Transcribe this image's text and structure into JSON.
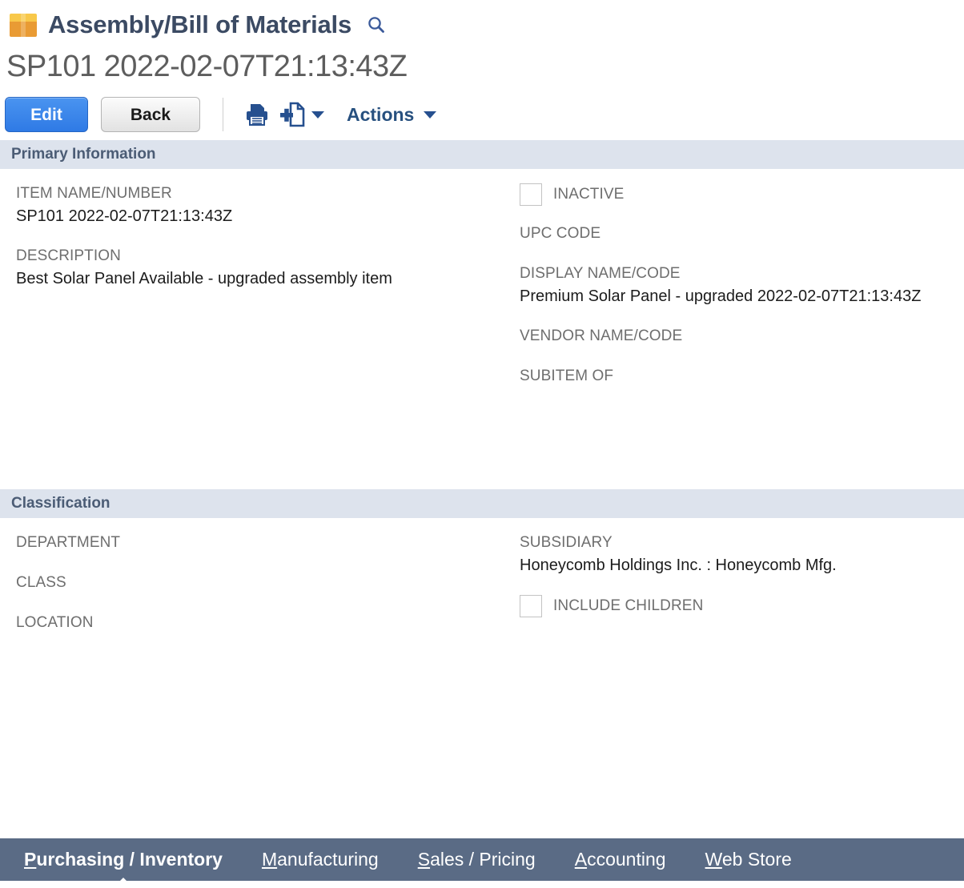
{
  "header": {
    "record_type_icon": "package-box-icon",
    "record_type": "Assembly/Bill of Materials",
    "search_icon": "search-icon"
  },
  "record": {
    "title": "SP101 2022-02-07T21:13:43Z"
  },
  "toolbar": {
    "edit_label": "Edit",
    "back_label": "Back",
    "print_icon": "print-icon",
    "new_document_icon": "new-document-icon",
    "actions_label": "Actions"
  },
  "sections": [
    {
      "title": "Primary Information",
      "left_fields": [
        {
          "label": "ITEM NAME/NUMBER",
          "value": "SP101 2022-02-07T21:13:43Z"
        },
        {
          "label": "DESCRIPTION",
          "value": "Best Solar Panel Available - upgraded assembly item"
        }
      ],
      "right_checkbox": {
        "label": "INACTIVE",
        "checked": false
      },
      "right_fields": [
        {
          "label": "UPC CODE",
          "value": ""
        },
        {
          "label": "DISPLAY NAME/CODE",
          "value": "Premium Solar Panel - upgraded 2022-02-07T21:13:43Z"
        },
        {
          "label": "VENDOR NAME/CODE",
          "value": ""
        },
        {
          "label": "SUBITEM OF",
          "value": ""
        }
      ]
    },
    {
      "title": "Classification",
      "left_fields": [
        {
          "label": "DEPARTMENT",
          "value": ""
        },
        {
          "label": "CLASS",
          "value": ""
        },
        {
          "label": "LOCATION",
          "value": ""
        }
      ],
      "right_fields": [
        {
          "label": "SUBSIDIARY",
          "value": "Honeycomb Holdings Inc. : Honeycomb Mfg."
        }
      ],
      "right_checkbox": {
        "label": "INCLUDE CHILDREN",
        "checked": false
      }
    }
  ],
  "tabs": [
    {
      "accesskey": "P",
      "rest": "urchasing / Inventory",
      "active": true
    },
    {
      "accesskey": "M",
      "rest": "anufacturing",
      "active": false
    },
    {
      "accesskey": "S",
      "rest": "ales / Pricing",
      "active": false
    },
    {
      "accesskey": "A",
      "rest": "ccounting",
      "active": false
    },
    {
      "accesskey": "W",
      "rest": "eb Store",
      "active": false
    }
  ],
  "colors": {
    "accent_blue": "#2f7ae5",
    "section_header_bg": "#dde3ed",
    "tab_bar_bg": "#5a6b85",
    "icon_orange": "#e99b34",
    "icon_yellow": "#f8c84a"
  }
}
